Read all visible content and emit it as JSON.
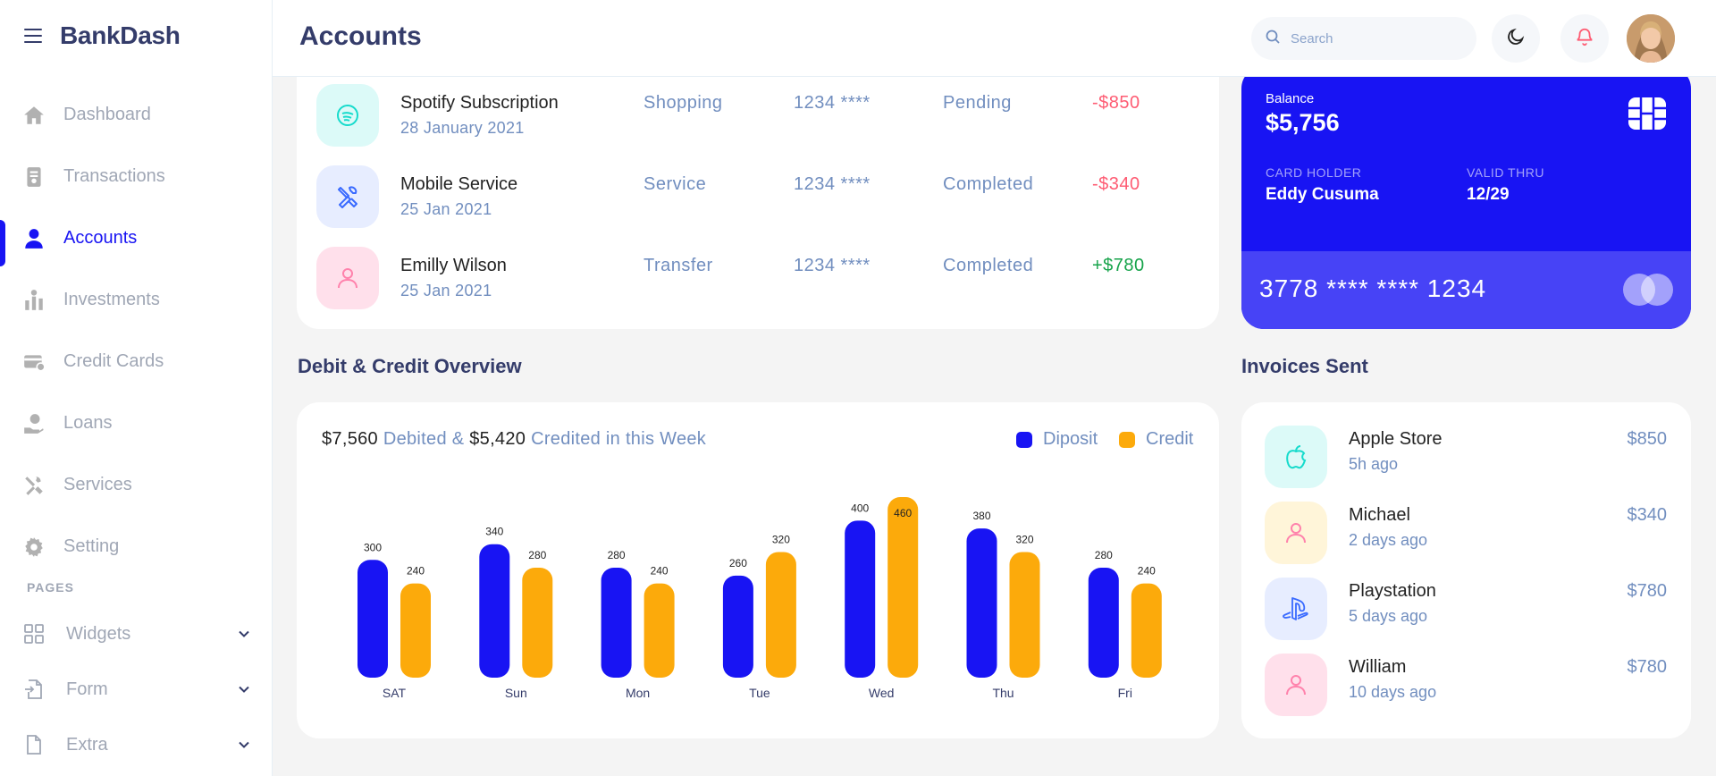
{
  "app": {
    "brand": "BankDash"
  },
  "sidebar": {
    "items": [
      {
        "label": "Dashboard",
        "icon": "home-icon",
        "active": false
      },
      {
        "label": "Transactions",
        "icon": "transactions-icon",
        "active": false
      },
      {
        "label": "Accounts",
        "icon": "user-icon",
        "active": true
      },
      {
        "label": "Investments",
        "icon": "investments-icon",
        "active": false
      },
      {
        "label": "Credit Cards",
        "icon": "credit-card-icon",
        "active": false
      },
      {
        "label": "Loans",
        "icon": "loan-icon",
        "active": false
      },
      {
        "label": "Services",
        "icon": "services-icon",
        "active": false
      },
      {
        "label": "Setting",
        "icon": "gear-icon",
        "active": false
      }
    ],
    "section_label": "PAGES",
    "pages": [
      {
        "label": "Widgets",
        "icon": "grid-icon"
      },
      {
        "label": "Form",
        "icon": "form-icon"
      },
      {
        "label": "Extra",
        "icon": "file-icon"
      }
    ]
  },
  "header": {
    "title": "Accounts",
    "search_placeholder": "Search"
  },
  "transactions": [
    {
      "name": "Spotify Subscription",
      "date": "28 January 2021",
      "category": "Shopping",
      "card": "1234 ****",
      "status": "Pending",
      "amount": "-$850",
      "icon": "spotify-icon",
      "icon_bg": "#dcfaf8",
      "icon_color": "#16dbcc"
    },
    {
      "name": "Mobile Service",
      "date": "25 Jan 2021",
      "category": "Service",
      "card": "1234 ****",
      "status": "Completed",
      "amount": "-$340",
      "icon": "tools-icon",
      "icon_bg": "#e7edff",
      "icon_color": "#396aff"
    },
    {
      "name": "Emilly Wilson",
      "date": "25 Jan 2021",
      "category": "Transfer",
      "card": "1234 ****",
      "status": "Completed",
      "amount": "+$780",
      "icon": "user-icon",
      "icon_bg": "#ffe0eb",
      "icon_color": "#ff82ac"
    }
  ],
  "balance_card": {
    "label": "Balance",
    "amount": "$5,756",
    "holder_label": "CARD HOLDER",
    "holder": "Eddy Cusuma",
    "valid_label": "VALID THRU",
    "valid": "12/29",
    "number": "3778 **** **** 1234"
  },
  "overview": {
    "title": "Debit & Credit Overview",
    "debited": "$7,560",
    "debited_text": " Debited & ",
    "credited": "$5,420",
    "credited_text": " Credited in this Week",
    "legend": [
      {
        "label": "Diposit",
        "color": "#1814f3"
      },
      {
        "label": "Credit",
        "color": "#fcaa0b"
      }
    ]
  },
  "chart_data": {
    "type": "bar",
    "categories": [
      "SAT",
      "Sun",
      "Mon",
      "Tue",
      "Wed",
      "Thu",
      "Fri"
    ],
    "series": [
      {
        "name": "Diposit",
        "values": [
          300,
          340,
          280,
          260,
          400,
          380,
          280
        ],
        "color": "#1814f3"
      },
      {
        "name": "Credit",
        "values": [
          240,
          280,
          240,
          320,
          460,
          320,
          240
        ],
        "color": "#fcaa0b"
      }
    ],
    "ylim": [
      0,
      460
    ],
    "grid": false,
    "legend_position": "top-right",
    "data_labels": true
  },
  "invoices": {
    "title": "Invoices Sent",
    "items": [
      {
        "name": "Apple Store",
        "time": "5h ago",
        "amount": "$850",
        "icon": "apple-icon",
        "icon_bg": "#dcfaf8",
        "icon_color": "#16dbcc"
      },
      {
        "name": "Michael",
        "time": "2 days ago",
        "amount": "$340",
        "icon": "user-icon",
        "icon_bg": "#fff5d9",
        "icon_color": "#ff82ac"
      },
      {
        "name": "Playstation",
        "time": "5 days ago",
        "amount": "$780",
        "icon": "playstation-icon",
        "icon_bg": "#e7edff",
        "icon_color": "#396aff"
      },
      {
        "name": "William",
        "time": "10 days ago",
        "amount": "$780",
        "icon": "user-icon",
        "icon_bg": "#ffe0eb",
        "icon_color": "#ff82ac"
      }
    ]
  }
}
